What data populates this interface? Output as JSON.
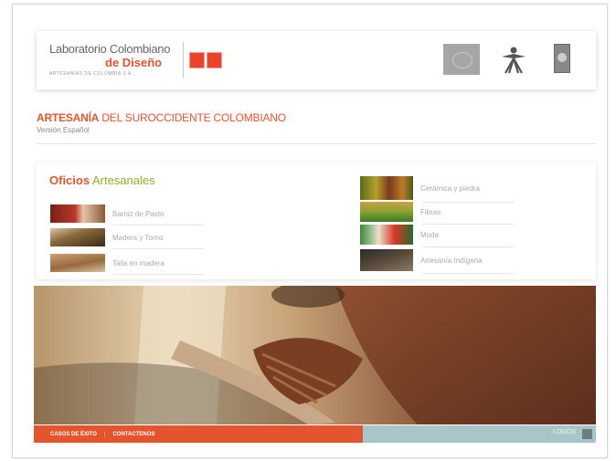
{
  "header": {
    "logo_line1": "Laboratorio Colombiano",
    "logo_line2": "de Diseño",
    "logo_tagline": "ARTESANÍAS DE COLOMBIA S.A.",
    "partner_icons": [
      "flag-icon",
      "sena-icon",
      "badge-icon"
    ]
  },
  "page": {
    "title_bold": "ARTESANÍA",
    "title_rest": " DEL SUROCCIDENTE COLOMBIANO",
    "version": "Versión Español"
  },
  "section": {
    "title_word1": "Oficios",
    "title_word2": " Artesanales"
  },
  "crafts_left": [
    {
      "label": "Barniz de Pasto"
    },
    {
      "label": "Madera y Torno"
    },
    {
      "label": "Talla en madera"
    }
  ],
  "crafts_right": [
    {
      "label": "Cerámica y piedra"
    },
    {
      "label": "Fibras"
    },
    {
      "label": "Moda"
    },
    {
      "label": "Artesanía Indígena"
    }
  ],
  "footer": {
    "link1": "CASOS DE ÉXITO",
    "link2": "CONTACTENOS",
    "separator": "|",
    "right_label": "LOGOS"
  },
  "colors": {
    "accent": "#e4542e",
    "olive": "#9aaa2a",
    "footer_right": "#a8c6c9"
  }
}
